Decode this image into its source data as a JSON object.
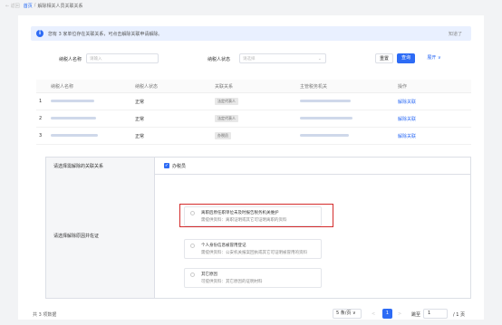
{
  "topbar": {
    "back": "← 返回",
    "home": "首页",
    "current": "解除相关人员关联关系"
  },
  "notice": {
    "text": "您有 3 家单位存在关联关系，可点击解除关联申请解除。",
    "dismiss": "知道了"
  },
  "search": {
    "name_label": "纳税人名称",
    "name_placeholder": "请输入",
    "status_label": "纳税人状态",
    "status_placeholder": "请选择",
    "reset": "重置",
    "query": "查询",
    "expand": "展开 ∨"
  },
  "table": {
    "headers": [
      "",
      "纳税人名称",
      "纳税人状态",
      "关联关系",
      "主管税务机关",
      "操作"
    ],
    "rows": [
      {
        "index": "1",
        "status": "正常",
        "relation": "法定代表人",
        "action": "解除关联"
      },
      {
        "index": "2",
        "status": "正常",
        "relation": "法定代表人",
        "action": "解除关联"
      },
      {
        "index": "3",
        "status": "正常",
        "relation": "办税员",
        "action": "解除关联"
      }
    ]
  },
  "form": {
    "relation_label": "请选择需解除的关联关系",
    "relation_option": "办税员",
    "reason_label": "请选择解除原因并佐证",
    "options": [
      {
        "title": "离职后原任职单位未及时报告税务机关维护",
        "desc": "需提供资料：离职证明或其它可证明离职的资料"
      },
      {
        "title": "个人身份信息被冒用登记",
        "desc": "需提供资料：公安机关报案回执或其它可证明被冒用的资料"
      },
      {
        "title": "其它原因",
        "desc": "可提供资料：其它原因的证明材料"
      }
    ]
  },
  "footer": {
    "total": "共 3 项数据",
    "page_size": "5 条/页 ∨",
    "prev": "<",
    "current_page": "1",
    "next": ">",
    "jump": "跳至",
    "jump_value": "1",
    "total_pages": "/ 1 页"
  },
  "colors": {
    "accent": "#2d6bf5",
    "highlight": "#d42b2b"
  }
}
